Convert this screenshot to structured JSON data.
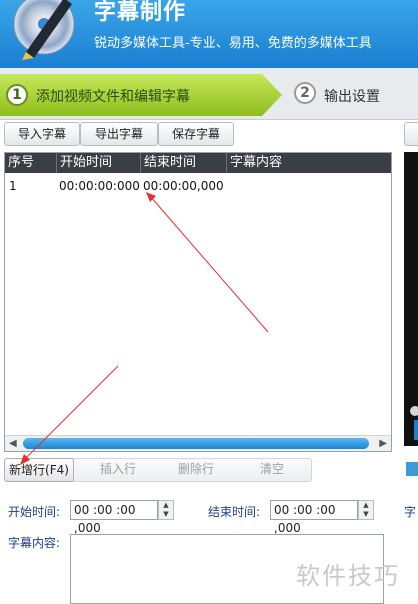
{
  "header": {
    "title": "字幕制作",
    "subtitle": "锐动多媒体工具-专业、易用、免费的多媒体工具"
  },
  "steps": [
    {
      "number": "1",
      "label": "添加视频文件和编辑字幕",
      "active": true
    },
    {
      "number": "2",
      "label": "输出设置",
      "active": false
    }
  ],
  "toolbar": {
    "import_label": "导入字幕",
    "export_label": "导出字幕",
    "save_label": "保存字幕"
  },
  "table": {
    "columns": [
      "序号",
      "开始时间",
      "结束时间",
      "字幕内容"
    ],
    "rows": [
      {
        "index": "1",
        "start": "00:00:00:000",
        "end": "00:00:00,000",
        "content": ""
      }
    ]
  },
  "actions": {
    "add_label": "新增行(F4)",
    "insert_label": "插入行",
    "delete_label": "删除行",
    "clear_label": "清空"
  },
  "form": {
    "start_label": "开始时间:",
    "start_value": "00 :00 :00 ,000",
    "end_label": "结束时间:",
    "end_value": "00 :00 :00 ,000",
    "content_label": "字幕内容:",
    "right_stub_label": "字"
  },
  "watermark": "软件技巧",
  "colors": {
    "header_blue": "#1b7fd0",
    "step_active_green": "#a3d02f",
    "table_header": "#3a3f45",
    "annotation_red": "#e03030"
  }
}
